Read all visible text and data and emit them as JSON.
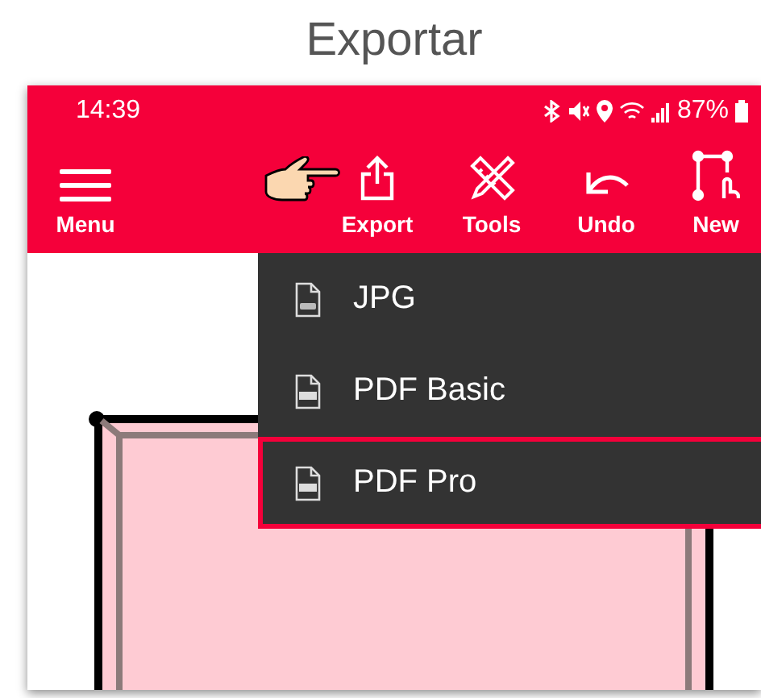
{
  "heading": "Exportar",
  "status_bar": {
    "time": "14:39",
    "battery": "87%"
  },
  "toolbar": {
    "menu": "Menu",
    "actions": [
      {
        "label": "Export",
        "kind": "export"
      },
      {
        "label": "Tools",
        "kind": "tools"
      },
      {
        "label": "Undo",
        "kind": "undo"
      },
      {
        "label": "New",
        "kind": "new"
      }
    ]
  },
  "export_menu": [
    {
      "label": "JPG",
      "kind": "jpg",
      "selected": false
    },
    {
      "label": "PDF Basic",
      "kind": "pdf",
      "selected": false
    },
    {
      "label": "PDF Pro",
      "kind": "pdf",
      "selected": true
    }
  ]
}
